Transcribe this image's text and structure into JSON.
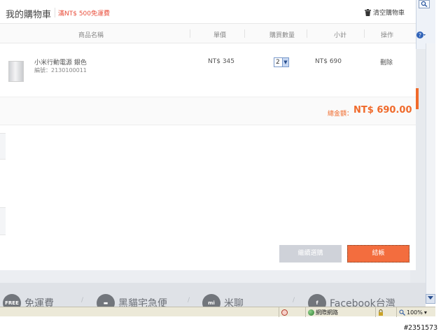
{
  "cart": {
    "title": "我的購物車",
    "promo": "滿NT$ 500免運費",
    "clear_label": "清空購物車",
    "columns": [
      "商品名稱",
      "單價",
      "購買數量",
      "小計",
      "操作"
    ],
    "items": [
      {
        "name": "小米行動電源 銀色",
        "code": "編號：2130100011",
        "price": "NT$ 345",
        "quantity": "2",
        "subtotal": "NT$ 690",
        "action": "刪除"
      }
    ],
    "total_label": "總金額：",
    "total_value": "NT$ 690.00",
    "continue_label": "繼續選購",
    "checkout_label": "結帳"
  },
  "footer": {
    "services": [
      {
        "icon": "free-shipping-icon",
        "icon_text": "FREE",
        "label": "免運費"
      },
      {
        "icon": "truck-icon",
        "icon_text": "▬",
        "label": "黑貓宅急便"
      },
      {
        "icon": "mi-icon",
        "icon_text": "mi",
        "label": "米聊"
      },
      {
        "icon": "facebook-icon",
        "icon_text": "f",
        "label": "Facebook台灣"
      }
    ]
  },
  "status_bar": {
    "zone": "網際網路",
    "zoom": "100%"
  },
  "watermark": "#2351573",
  "colors": {
    "accent": "#f06a2b",
    "checkout": "#f36d3e",
    "promo": "#e94e3b",
    "continue": "#cfd2d9"
  }
}
